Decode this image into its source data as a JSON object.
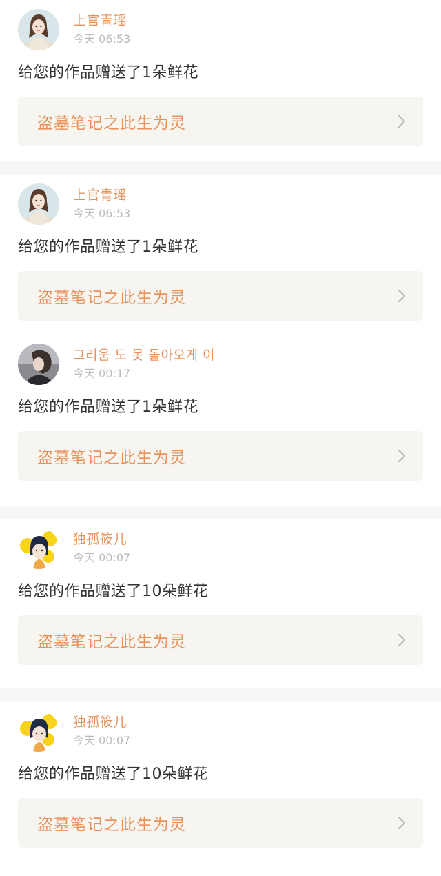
{
  "notifications": [
    {
      "user_name": "上官青瑶",
      "time": "今天 06:53",
      "message": "给您的作品赠送了1朵鲜花",
      "work_title": "盗墓笔记之此生为灵",
      "avatar_icon": "girl-scarf-avatar"
    },
    {
      "user_name": "上官青瑶",
      "time": "今天 06:53",
      "message": "给您的作品赠送了1朵鲜花",
      "work_title": "盗墓笔记之此生为灵",
      "avatar_icon": "girl-scarf-avatar"
    },
    {
      "user_name": "그리움 도 못 돌아오게 이",
      "time": "今天 00:17",
      "message": "给您的作品赠送了1朵鲜花",
      "work_title": "盗墓笔记之此生为灵",
      "avatar_icon": "girl-photo-avatar"
    },
    {
      "user_name": "独孤筱儿",
      "time": "今天 00:07",
      "message": "给您的作品赠送了10朵鲜花",
      "work_title": "盗墓笔记之此生为灵",
      "avatar_icon": "cartoon-yellow-avatar"
    },
    {
      "user_name": "独孤筱儿",
      "time": "今天 00:07",
      "message": "给您的作品赠送了10朵鲜花",
      "work_title": "盗墓笔记之此生为灵",
      "avatar_icon": "cartoon-yellow-avatar"
    }
  ],
  "colors": {
    "accent": "#e8935e",
    "work_bg": "#f6f5ef",
    "divider": "#f7f7f7",
    "time": "#bbbbbb"
  }
}
